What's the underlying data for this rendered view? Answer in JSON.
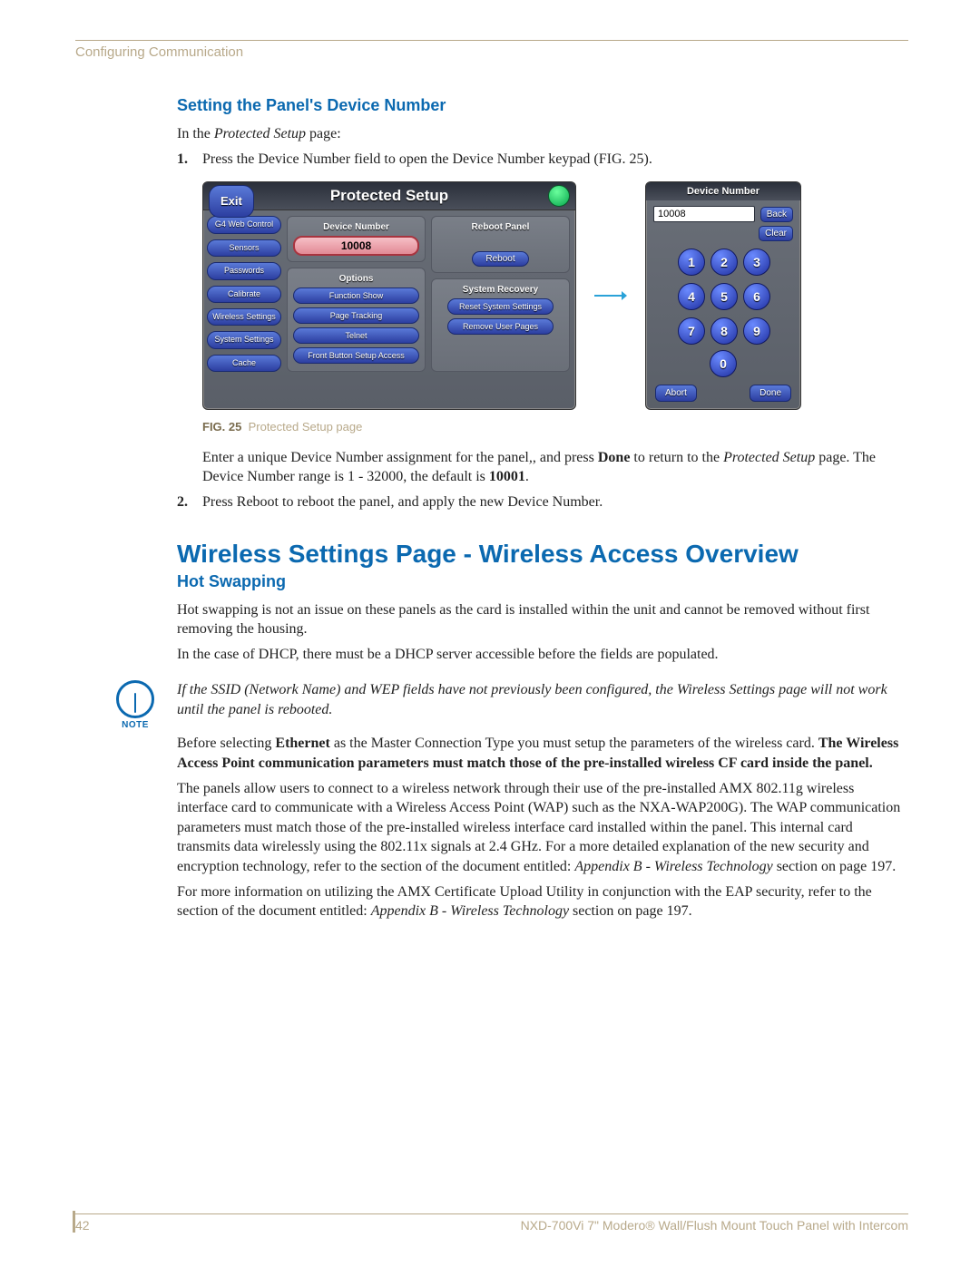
{
  "running_head": "Configuring Communication",
  "section1": {
    "title": "Setting the Panel's Device Number",
    "intro_pre": "In the ",
    "intro_it": "Protected Setup",
    "intro_post": " page:",
    "step1_a": "Press the ",
    "step1_it": "Device Number",
    "step1_b": " field to open the Device Number keypad (FIG. 25).",
    "step1c_a": "Enter a unique Device Number assignment for the panel",
    "step1c_b": ", and press ",
    "step1c_bd1": "Done",
    "step1c_c": " to return to the ",
    "step1c_it": "Protected Setup",
    "step1c_d": " page. The Device Number range is 1 - 32000, the default is ",
    "step1c_bd2": "10001",
    "step1c_e": ".",
    "step2_a": "Press ",
    "step2_bd": "Reboot",
    "step2_b": " to reboot the panel, and apply the new Device Number."
  },
  "fig": {
    "num": "FIG. 25",
    "caption": "Protected Setup page",
    "ps_title": "Protected Setup",
    "exit": "Exit",
    "side": [
      "G4 Web Control",
      "Sensors",
      "Passwords",
      "Calibrate",
      "Wireless Settings",
      "System Settings",
      "Cache"
    ],
    "dev_label": "Device Number",
    "dev_value": "10008",
    "options_label": "Options",
    "opts": [
      "Function Show",
      "Page Tracking",
      "Telnet",
      "Front Button Setup Access"
    ],
    "reboot_label": "Reboot Panel",
    "reboot_btn": "Reboot",
    "recov_label": "System Recovery",
    "recov_btns": [
      "Reset System Settings",
      "Remove User Pages"
    ],
    "kp_title": "Device Number",
    "kp_value": "10008",
    "kp_back": "Back",
    "kp_clear": "Clear",
    "kp_nums": [
      "1",
      "2",
      "3",
      "4",
      "5",
      "6",
      "7",
      "8",
      "9"
    ],
    "kp_zero": "0",
    "kp_abort": "Abort",
    "kp_done": "Done"
  },
  "section2": {
    "title": "Wireless Settings Page - Wireless Access Overview",
    "sub": "Hot Swapping",
    "p1": "Hot swapping is not an issue on these panels as the card is installed within the unit and cannot be removed without first removing the housing.",
    "p2": "In the case of DHCP, there must be a DHCP server accessible before the fields are populated.",
    "note": "If the SSID (Network Name) and WEP fields have not previously been configured, the Wireless Settings page will not work until the panel is rebooted.",
    "p3_a": "Before selecting ",
    "p3_bd1": "Ethernet",
    "p3_b": " as the Master Connection Type you must setup the parameters of the wireless card. ",
    "p3_bd2": "The Wireless Access Point communication parameters must match those of the pre-installed wireless CF card inside the panel.",
    "p4_a": "The panels allow users to connect to a wireless network through their use of the pre-installed AMX 802.11g wireless interface card to communicate with a Wireless Access Point (WAP) such as the NXA-WAP200G). The WAP communication parameters must match those of the pre-installed wireless interface card installed within the panel. This internal card transmits data wirelessly using the 802.11x signals at 2.4 GHz. For a more detailed explanation of the new security and encryption technology, refer to the section of the document entitled: ",
    "p4_it": "Appendix B - Wireless Technology",
    "p4_b": " section on page 197.",
    "p5_a": "For more information on utilizing the AMX Certificate Upload Utility in conjunction with the EAP security, refer to the section of the document entitled: ",
    "p5_it": "Appendix B - Wireless Technology",
    "p5_b": " section on page 197."
  },
  "footer": {
    "page": "42",
    "product": "NXD-700Vi 7\" Modero® Wall/Flush Mount Touch Panel with Intercom"
  },
  "note_label": "NOTE"
}
